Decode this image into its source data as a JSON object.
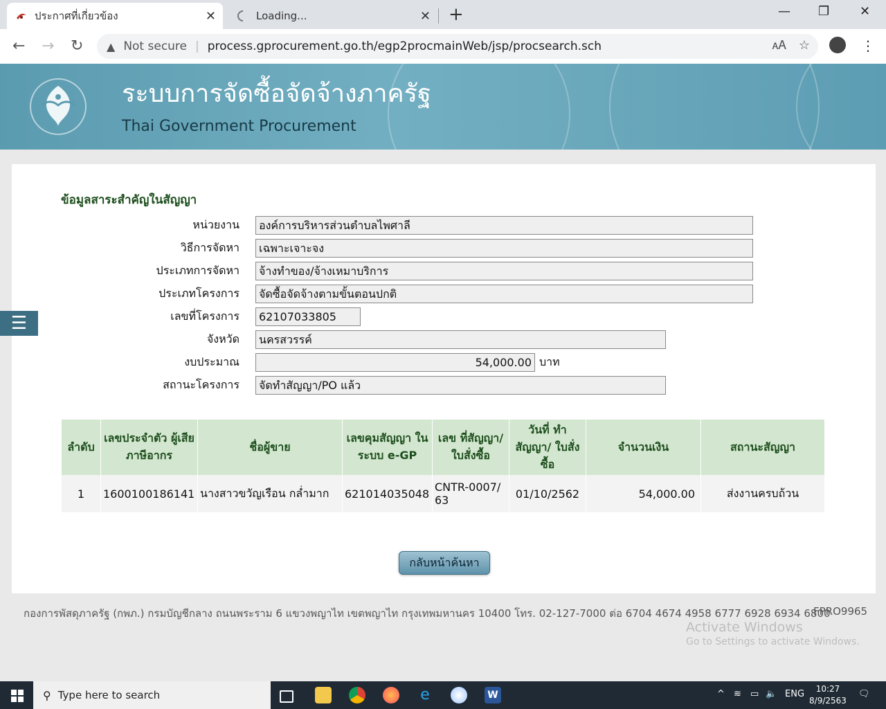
{
  "browser": {
    "tabs": [
      {
        "label": "ประกาศที่เกี่ยวข้อง",
        "active": true
      },
      {
        "label": "Loading...",
        "active": false
      }
    ],
    "not_secure": "Not secure",
    "url": "process.gprocurement.go.th/egp2procmainWeb/jsp/procsearch.sch"
  },
  "banner": {
    "title_th": "ระบบการจัดซื้อจัดจ้างภาครัฐ",
    "title_en": "Thai Government Procurement"
  },
  "section_title": "ข้อมูลสาระสำคัญในสัญญา",
  "fields": {
    "agency": {
      "label": "หน่วยงาน",
      "value": "องค์การบริหารส่วนตำบลไพศาลี"
    },
    "method": {
      "label": "วิธีการจัดหา",
      "value": "เฉพาะเจาะจง"
    },
    "proc_type": {
      "label": "ประเภทการจัดหา",
      "value": "จ้างทำของ/จ้างเหมาบริการ"
    },
    "project_type": {
      "label": "ประเภทโครงการ",
      "value": "จัดซื้อจัดจ้างตามขั้นตอนปกติ"
    },
    "project_no": {
      "label": "เลขที่โครงการ",
      "value": "62107033805"
    },
    "province": {
      "label": "จังหวัด",
      "value": "นครสวรรค์"
    },
    "budget": {
      "label": "งบประมาณ",
      "value": "54,000.00",
      "unit": "บาท"
    },
    "status": {
      "label": "สถานะโครงการ",
      "value": "จัดทำสัญญา/PO แล้ว"
    }
  },
  "table": {
    "headers": {
      "no": "ลำดับ",
      "taxid": "เลขประจำตัว ผู้เสียภาษีอากร",
      "seller": "ชื่อผู้ขาย",
      "control": "เลขคุมสัญญา ในระบบ e-GP",
      "contract_no": "เลข ที่สัญญา/ ใบสั่งซื้อ",
      "date": "วันที่ ทำสัญญา/ ใบสั่งซื้อ",
      "amount": "จำนวนเงิน",
      "cstatus": "สถานะสัญญา"
    },
    "rows": [
      {
        "no": "1",
        "taxid": "1600100186141",
        "seller": "นางสาวขวัญเรือน กล่ำมาก",
        "control": "621014035048",
        "contract_no": "CNTR-0007/63",
        "date": "01/10/2562",
        "amount": "54,000.00",
        "cstatus": "ส่งงานครบถ้วน"
      }
    ]
  },
  "back_button": "กลับหน้าค้นหา",
  "footer": {
    "text": "กองการพัสดุภาครัฐ (กพภ.) กรมบัญชีกลาง ถนนพระราม 6 แขวงพญาไท เขตพญาไท กรุงเทพมหานคร 10400 โทร. 02-127-7000 ต่อ 6704 4674 4958 6777 6928 6934 6800",
    "code": "FPRO9965"
  },
  "activate": {
    "title": "Activate Windows",
    "subtitle": "Go to Settings to activate Windows."
  },
  "taskbar": {
    "search_placeholder": "Type here to search",
    "lang": "ENG",
    "time": "10:27",
    "date": "8/9/2563"
  },
  "colors": {
    "banner": "#5b9bb0",
    "header_green": "#d3e6cf",
    "title_green": "#1d4e1d"
  }
}
